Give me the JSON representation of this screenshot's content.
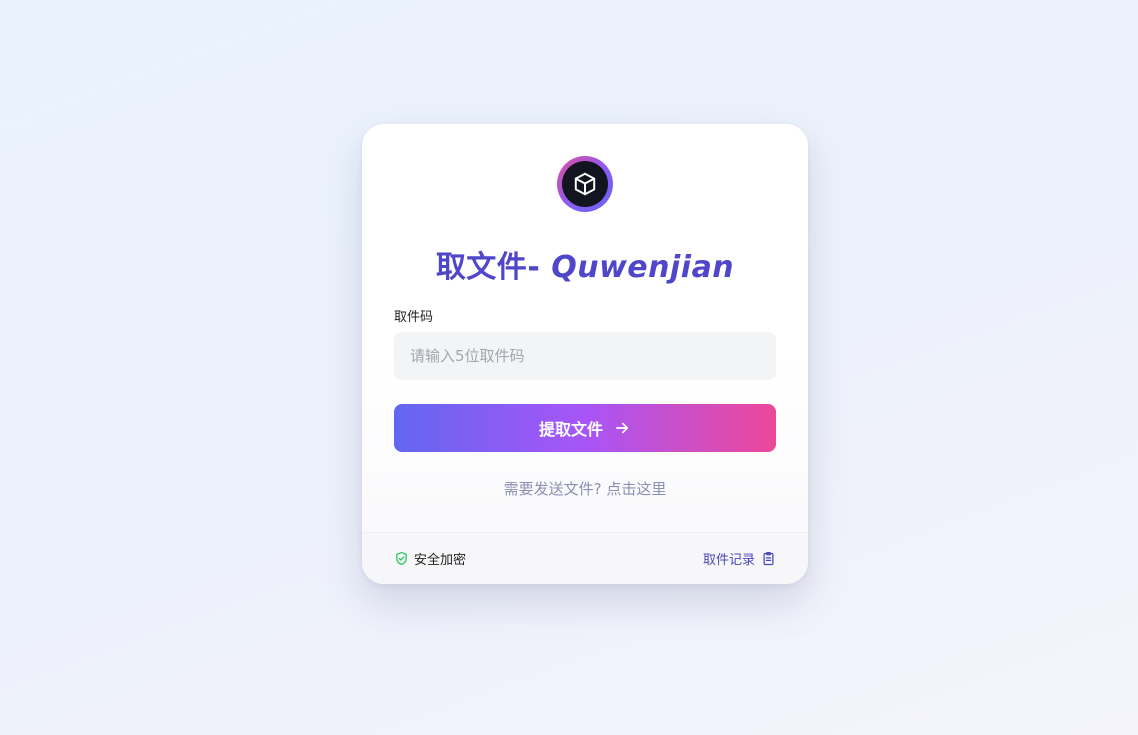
{
  "app": {
    "title_cn": "取文件",
    "title_sep": "- ",
    "title_en": "Quwenjian"
  },
  "form": {
    "code_label": "取件码",
    "code_placeholder": "请输入5位取件码",
    "code_value": "",
    "submit_label": "提取文件",
    "send_link": "需要发送文件? 点击这里"
  },
  "footer": {
    "secure_label": "安全加密",
    "history_label": "取件记录"
  },
  "icons": {
    "logo": "cube-icon",
    "submit": "arrow-right-icon",
    "secure": "shield-check-icon",
    "history": "clipboard-icon"
  },
  "colors": {
    "accent": "#4f46c9",
    "gradient_start": "#6366f1",
    "gradient_mid": "#a855f7",
    "gradient_end": "#ec4899",
    "secure_icon": "#22c55e"
  }
}
